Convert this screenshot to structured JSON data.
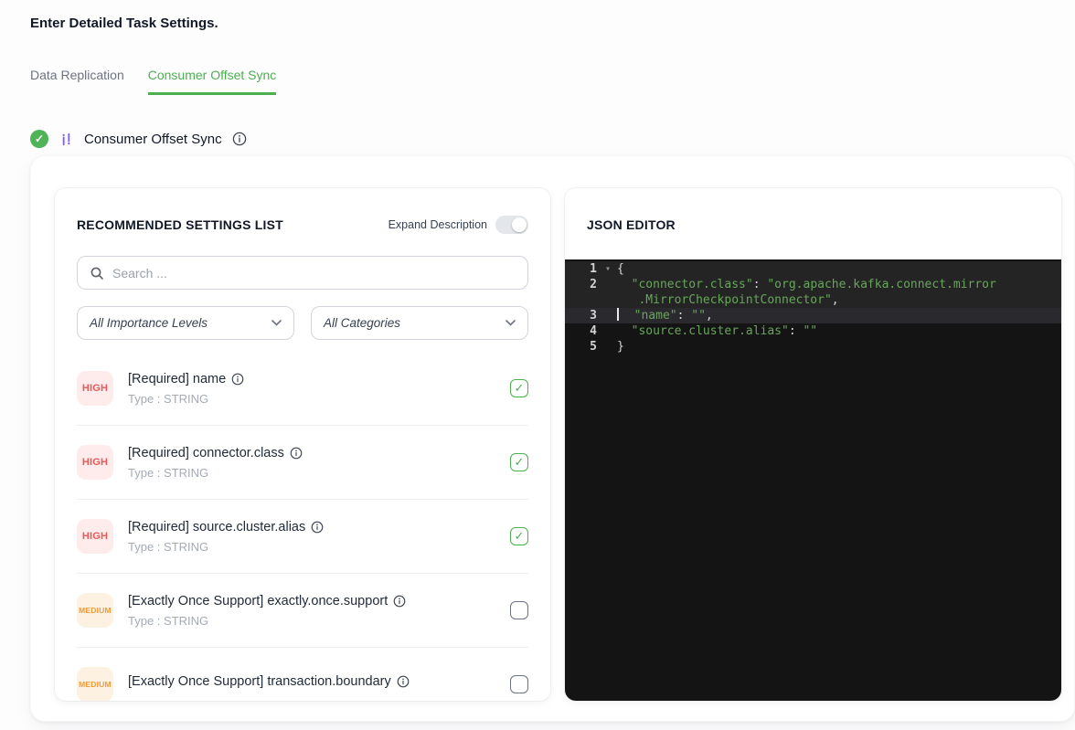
{
  "page": {
    "title": "Enter Detailed Task Settings."
  },
  "tabs": [
    {
      "label": "Data Replication"
    },
    {
      "label": "Consumer Offset Sync"
    }
  ],
  "section_header": {
    "title": "Consumer Offset Sync"
  },
  "settings_panel": {
    "title": "RECOMMENDED SETTINGS LIST",
    "expand_description_label": "Expand Description",
    "search_placeholder": "Search ...",
    "importance_filter_value": "All Importance Levels",
    "category_filter_value": "All Categories",
    "items": [
      {
        "importance": "HIGH",
        "label": "[Required] name",
        "type": "Type : STRING",
        "checked": true
      },
      {
        "importance": "HIGH",
        "label": "[Required] connector.class",
        "type": "Type : STRING",
        "checked": true
      },
      {
        "importance": "HIGH",
        "label": "[Required] source.cluster.alias",
        "type": "Type : STRING",
        "checked": true
      },
      {
        "importance": "MEDIUM",
        "label": "[Exactly Once Support] exactly.once.support",
        "type": "Type : STRING",
        "checked": false
      },
      {
        "importance": "MEDIUM",
        "label": "[Exactly Once Support] transaction.boundary",
        "type": "",
        "checked": false
      }
    ]
  },
  "json_editor": {
    "title": "JSON EDITOR",
    "line_numbers": {
      "n1": "1",
      "n2": "2",
      "n2w": "",
      "n3": "3",
      "n4": "4",
      "n5": "5"
    },
    "code": {
      "open_brace": "{",
      "connector_key": "\"connector.class\"",
      "colon": ": ",
      "connector_value_part1": "\"org.apache.kafka.connect.mirror",
      "connector_value_part2": ".MirrorCheckpointConnector\"",
      "comma": ",",
      "name_key": "\"name\"",
      "name_value": "\"\"",
      "alias_key": "\"source.cluster.alias\"",
      "alias_value": "\"\"",
      "close_brace": "}"
    }
  },
  "colors": {
    "accent_green": "#4caf50",
    "high_badge_text": "#e45b5b",
    "medium_badge_text": "#ef9b3a",
    "code_string_green": "#67a65b",
    "editor_background": "#141414"
  }
}
